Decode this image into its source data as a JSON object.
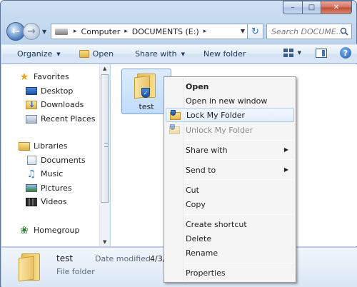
{
  "window": {
    "caption": {
      "minimize": "–",
      "maximize": "□",
      "close": "✕"
    }
  },
  "address_bar": {
    "parts": [
      "Computer",
      "DOCUMENTS (E:)"
    ],
    "separator": "▸",
    "search_placeholder": "Search DOCUME..."
  },
  "toolbar": {
    "organize": "Organize",
    "open": "Open",
    "share_with": "Share with",
    "new_folder": "New folder",
    "help": "?"
  },
  "nav_pane": {
    "favorites": {
      "label": "Favorites",
      "items": [
        "Desktop",
        "Downloads",
        "Recent Places"
      ]
    },
    "libraries": {
      "label": "Libraries",
      "items": [
        "Documents",
        "Music",
        "Pictures",
        "Videos"
      ]
    },
    "homegroup": "Homegroup"
  },
  "files": [
    {
      "name": "test",
      "icon": "locked-folder-icon",
      "selected": true
    }
  ],
  "details": {
    "name": "test",
    "type": "File folder",
    "date_label": "Date modified:",
    "date_value": "4/3/"
  },
  "context_menu": {
    "items": [
      {
        "label": "Open",
        "bold": true
      },
      {
        "label": "Open in new window"
      },
      {
        "label": "Lock My Folder",
        "highlighted": true,
        "icon": "lock-folder-icon"
      },
      {
        "label": "Unlock My Folder",
        "disabled": true,
        "icon": "unlock-folder-icon"
      },
      {
        "label": "Share with",
        "submenu": true
      },
      {
        "label": "Send to",
        "submenu": true
      },
      {
        "label": "Cut"
      },
      {
        "label": "Copy"
      },
      {
        "label": "Create shortcut"
      },
      {
        "label": "Delete"
      },
      {
        "label": "Rename"
      },
      {
        "label": "Properties"
      }
    ]
  },
  "colors": {
    "accent": "#2f6fbf",
    "selection": "#c1dcfc",
    "menu_highlight_border": "#aeccf3"
  }
}
